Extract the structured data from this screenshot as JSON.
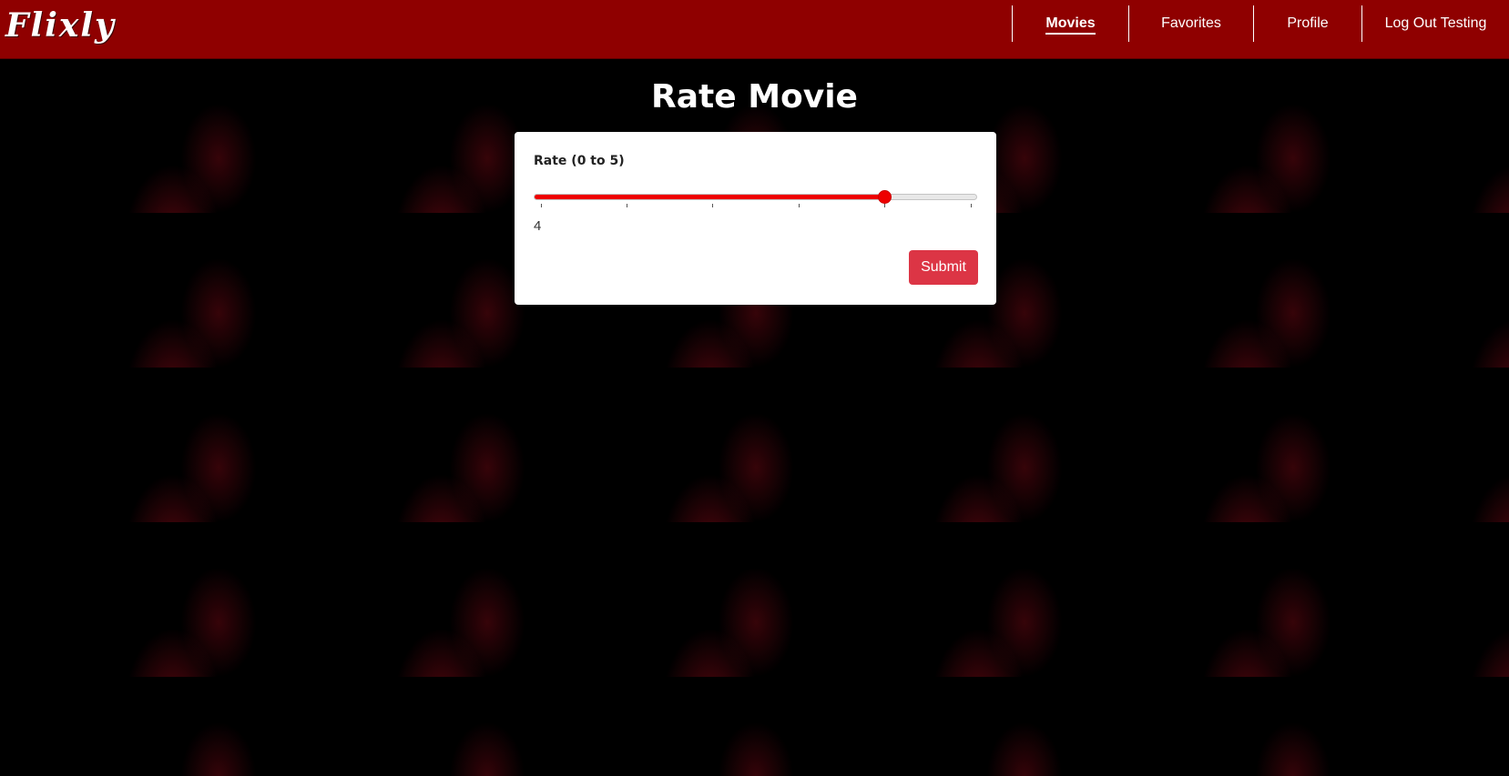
{
  "app": {
    "logo": "Flixly"
  },
  "nav": {
    "items": [
      {
        "label": "Movies",
        "active": true
      },
      {
        "label": "Favorites",
        "active": false
      },
      {
        "label": "Profile",
        "active": false
      },
      {
        "label": "Log Out Testing",
        "active": false
      }
    ]
  },
  "page": {
    "title": "Rate Movie"
  },
  "rating_form": {
    "label": "Rate (0 to 5)",
    "min": 0,
    "max": 5,
    "value": 4,
    "value_display": "4",
    "submit_label": "Submit"
  },
  "colors": {
    "nav_background": "#8f0000",
    "slider_accent": "#ee0000",
    "submit_background": "#dc3545",
    "page_background": "#000000"
  }
}
